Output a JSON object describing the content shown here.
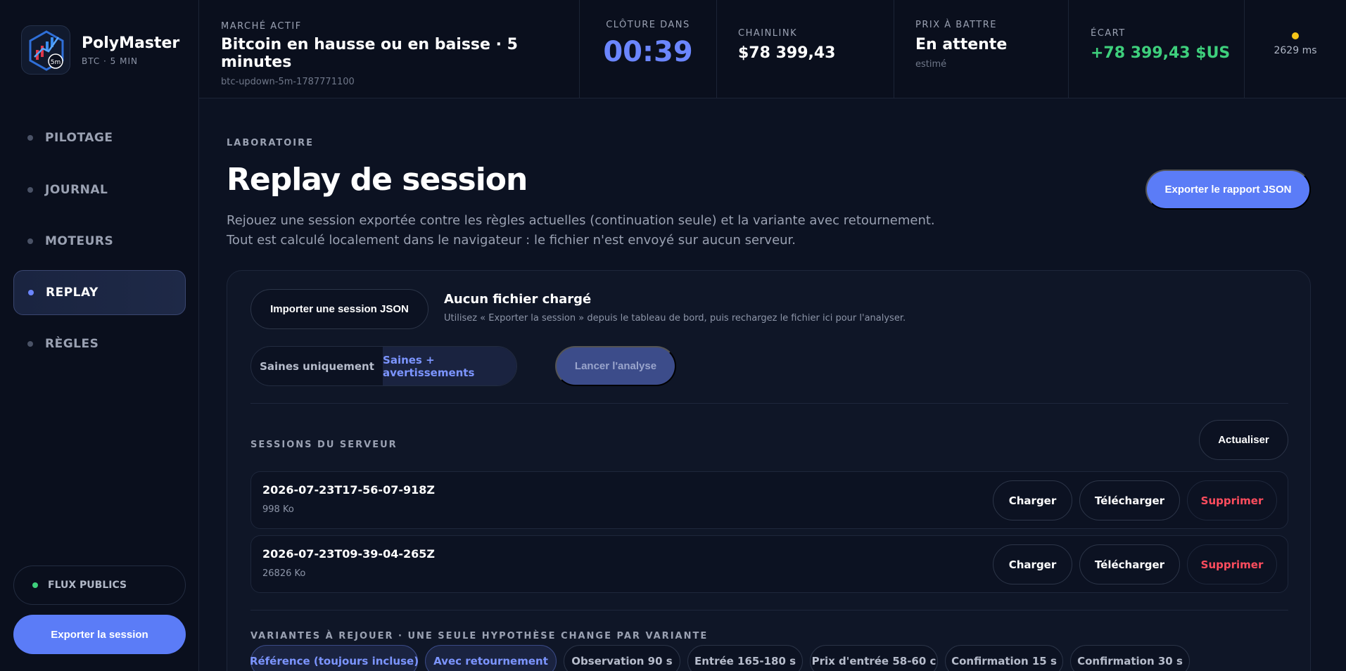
{
  "brand": {
    "name": "PolyMaster",
    "sub": "BTC · 5 MIN",
    "logo_badge": "5m"
  },
  "nav": [
    {
      "label": "PILOTAGE",
      "active": false
    },
    {
      "label": "JOURNAL",
      "active": false
    },
    {
      "label": "MOTEURS",
      "active": false
    },
    {
      "label": "REPLAY",
      "active": true
    },
    {
      "label": "RÈGLES",
      "active": false
    }
  ],
  "sidebar_footer": {
    "flux_label": "FLUX PUBLICS",
    "export_session_label": "Exporter la session"
  },
  "topbar": {
    "market": {
      "label": "MARCHÉ ACTIF",
      "title": "Bitcoin en hausse ou en baisse · 5 minutes",
      "slug": "btc-updown-5m-1787771100"
    },
    "close": {
      "label": "CLÔTURE DANS",
      "value": "00:39"
    },
    "chainlink": {
      "label": "CHAINLINK",
      "value": "$78 399,43"
    },
    "target": {
      "label": "PRIX À BATTRE",
      "value": "En attente",
      "note": "estimé"
    },
    "gap": {
      "label": "ÉCART",
      "value": "+78 399,43 $US"
    },
    "latency": {
      "value": "2629 ms"
    }
  },
  "page": {
    "eyebrow": "LABORATOIRE",
    "title": "Replay de session",
    "desc_line1": "Rejouez une session exportée contre les règles actuelles (continuation seule) et la variante avec retournement.",
    "desc_line2": "Tout est calculé localement dans le navigateur : le fichier n'est envoyé sur aucun serveur.",
    "export_json_label": "Exporter le rapport JSON"
  },
  "import": {
    "button_label": "Importer une session JSON",
    "status_title": "Aucun fichier chargé",
    "status_hint": "Utilisez « Exporter la session » depuis le tableau de bord, puis rechargez le fichier ici pour l'analyser."
  },
  "filter": {
    "option1": "Saines uniquement",
    "option2": "Saines + avertissements",
    "launch_label": "Lancer l'analyse"
  },
  "server_sessions": {
    "label": "SESSIONS DU SERVEUR",
    "refresh_label": "Actualiser",
    "load_label": "Charger",
    "download_label": "Télécharger",
    "delete_label": "Supprimer",
    "rows": [
      {
        "name": "2026-07-23T17-56-07-918Z",
        "size": "998 Ko"
      },
      {
        "name": "2026-07-23T09-39-04-265Z",
        "size": "26826 Ko"
      }
    ]
  },
  "variants": {
    "label": "VARIANTES À REJOUER · UNE SEULE HYPOTHÈSE CHANGE PAR VARIANTE",
    "chips": [
      "Référence (toujours incluse)",
      "Avec retournement",
      "Observation 90 s",
      "Entrée 165-180 s",
      "Prix d'entrée 58-60 c",
      "Confirmation 15 s",
      "Confirmation 30 s"
    ]
  },
  "colors": {
    "accent": "#5b7cf7",
    "positive": "#3ecf7c",
    "danger": "#ff4d5e",
    "live_dot": "#f5c518",
    "countdown": "#6b86ff"
  }
}
